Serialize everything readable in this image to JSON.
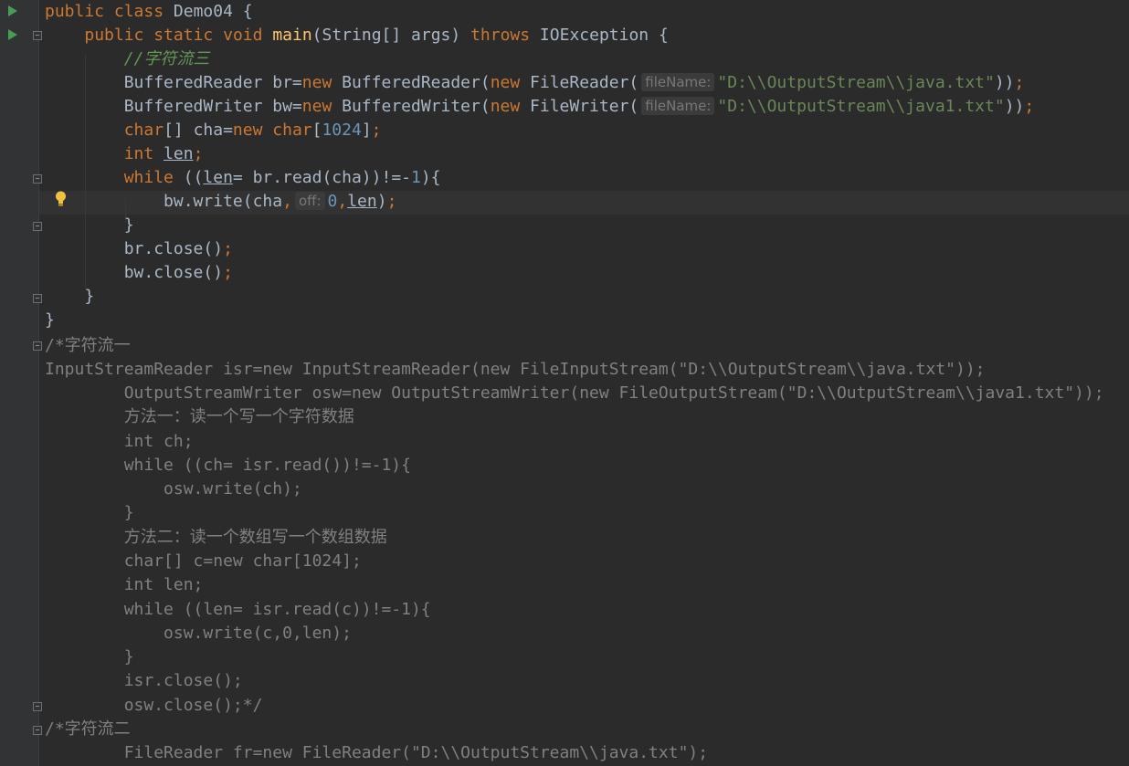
{
  "editor": {
    "file": {
      "class_keyword_public": "public",
      "class_keyword_class": "class",
      "class_name": "Demo04",
      "open_brace": " {"
    },
    "line2": {
      "public": "public",
      "static": "static",
      "void": "void",
      "method_name": "main",
      "params": "(String[] args) ",
      "throws": "throws",
      "exception": " IOException {"
    },
    "line3": {
      "comment": "//字符流三"
    },
    "line4": {
      "type": "BufferedReader br=",
      "new1": "new",
      "ctor": " BufferedReader(",
      "new2": "new",
      "ctor2": " FileReader(",
      "hint": "fileName:",
      "string": "\"D:\\\\OutputStream\\\\java.txt\"",
      "tail": "))",
      "semi": ";"
    },
    "line5": {
      "type": "BufferedWriter bw=",
      "new1": "new",
      "ctor": " BufferedWriter(",
      "new2": "new",
      "ctor2": " FileWriter(",
      "hint": "fileName:",
      "string": "\"D:\\\\OutputStream\\\\java1.txt\"",
      "tail": "))",
      "semi": ";"
    },
    "line6": {
      "char1": "char",
      "mid": "[] cha=",
      "new": "new",
      "char2": " char",
      "open": "[",
      "num": "1024",
      "close": "]",
      "semi": ";"
    },
    "line7": {
      "int": "int",
      "var": "len",
      "semi": ";"
    },
    "line8": {
      "while": "while",
      "open": " ((",
      "var": "len",
      "rest": "= br.read(cha))!=-",
      "num": "1",
      "close": "){"
    },
    "line9": {
      "call": "bw.write(cha",
      "comma1": ",",
      "hint": "off:",
      "num": "0",
      "comma2": ",",
      "var": "len",
      "close": ")",
      "semi": ";"
    },
    "line10": {
      "text": "}"
    },
    "line11": {
      "call": "br.close()",
      "semi": ";"
    },
    "line12": {
      "call": "bw.close()",
      "semi": ";"
    },
    "line13": {
      "text": "}"
    },
    "line14": {
      "text": "}"
    },
    "comment_block": [
      "/*字符流一",
      "InputStreamReader isr=new InputStreamReader(new FileInputStream(\"D:\\\\OutputStream\\\\java.txt\"));",
      "        OutputStreamWriter osw=new OutputStreamWriter(new FileOutputStream(\"D:\\\\OutputStream\\\\java1.txt\"));",
      "        方法一：读一个写一个字符数据",
      "        int ch;",
      "        while ((ch= isr.read())!=-1){",
      "            osw.write(ch);",
      "        }",
      "        方法二：读一个数组写一个数组数据",
      "        char[] c=new char[1024];",
      "        int len;",
      "        while ((len= isr.read(c))!=-1){",
      "            osw.write(c,0,len);",
      "        }",
      "        isr.close();",
      "        osw.close();*/",
      "/*字符流二",
      "        FileReader fr=new FileReader(\"D:\\\\OutputStream\\\\java.txt\");"
    ]
  },
  "colors": {
    "background": "#2b2b2b",
    "gutter": "#313335",
    "keyword": "#cc7832",
    "method": "#ffc66d",
    "string": "#6a8759",
    "number": "#6897bb",
    "comment": "#808080",
    "doc_comment": "#629755",
    "text": "#a9b7c6"
  },
  "icons": [
    "run-icon",
    "fold-icon",
    "intention-bulb-icon"
  ]
}
